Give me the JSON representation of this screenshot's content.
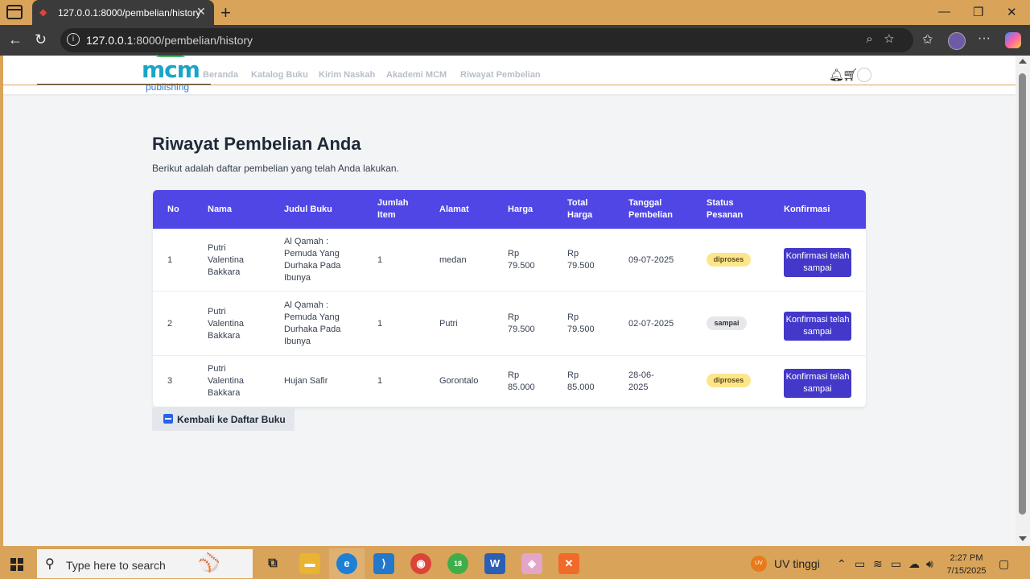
{
  "browser": {
    "tab_title": "127.0.0.1:8000/pembelian/history",
    "url_host": "127.0.0.1",
    "url_rest": ":8000/pembelian/history"
  },
  "site": {
    "logo_text": "mcm",
    "logo_sub": "publishing",
    "nav": [
      "Beranda",
      "Katalog Buku",
      "Kirim Naskah",
      "Akademi MCM",
      "Riwayat Pembelian"
    ]
  },
  "page": {
    "title": "Riwayat Pembelian Anda",
    "subtitle": "Berikut adalah daftar pembelian yang telah Anda lakukan."
  },
  "table": {
    "headers": {
      "no": "No",
      "nama": "Nama",
      "judul": "Judul Buku",
      "jumlah": "Jumlah Item",
      "alamat": "Alamat",
      "harga": "Harga",
      "total": "Total Harga",
      "tanggal": "Tanggal Pembelian",
      "status": "Status Pesanan",
      "konfirmasi": "Konfirmasi"
    },
    "rows": [
      {
        "no": "1",
        "nama": "Putri Valentina Bakkara",
        "judul": "Al Qamah : Pemuda Yang Durhaka Pada Ibunya",
        "jumlah": "1",
        "alamat": "medan",
        "harga": "Rp 79.500",
        "total": "Rp 79.500",
        "tanggal": "09-07-2025",
        "status": "diproses",
        "button": "Konfirmasi telah sampai"
      },
      {
        "no": "2",
        "nama": "Putri Valentina Bakkara",
        "judul": "Al Qamah : Pemuda Yang Durhaka Pada Ibunya",
        "jumlah": "1",
        "alamat": "Putri",
        "harga": "Rp 79.500",
        "total": "Rp 79.500",
        "tanggal": "02-07-2025",
        "status": "sampai",
        "button": "Konfirmasi telah sampai"
      },
      {
        "no": "3",
        "nama": "Putri Valentina Bakkara",
        "judul": "Hujan Safir",
        "jumlah": "1",
        "alamat": "Gorontalo",
        "harga": "Rp 85.000",
        "total": "Rp 85.000",
        "tanggal": "28-06-2025",
        "status": "diproses",
        "button": "Konfirmasi telah sampai"
      }
    ]
  },
  "back_button": "Kembali ke Daftar Buku",
  "taskbar": {
    "search_placeholder": "Type here to search",
    "weather_icon_text": "UV",
    "weather": "UV tinggi",
    "chrome_badge": "18",
    "time": "2:27 PM",
    "date": "7/15/2025"
  },
  "colors": {
    "accent": "#4f46e5",
    "button": "#4338ca",
    "badge_diproses": "#fde68a",
    "badge_sampai": "#e5e7eb",
    "browser_frame": "#d9a45a"
  }
}
